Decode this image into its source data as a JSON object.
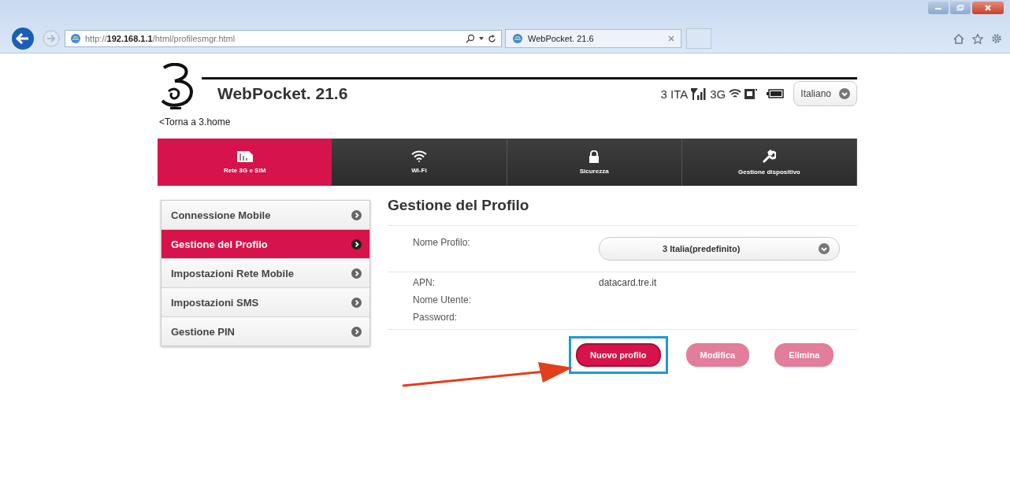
{
  "browser": {
    "url_prefix": "http://",
    "url_host": "192.168.1.1",
    "url_path": "/html/profilesmgr.html",
    "tab_title": "WebPocket. 21.6"
  },
  "header": {
    "title": "WebPocket. 21.6",
    "operator": "3 ITA",
    "network": "3G",
    "language": "Italiano",
    "back_link": "<Torna a 3.home"
  },
  "tabs": [
    {
      "label": "Rete 3G e SIM",
      "kind": "sim",
      "selected": true
    },
    {
      "label": "Wi-Fi",
      "kind": "wifi",
      "selected": false
    },
    {
      "label": "Sicurezza",
      "kind": "lock",
      "selected": false
    },
    {
      "label": "Gestione dispositivo",
      "kind": "wrench",
      "selected": false
    }
  ],
  "sidebar": {
    "items": [
      {
        "label": "Connessione Mobile",
        "selected": false
      },
      {
        "label": "Gestione del Profilo",
        "selected": true
      },
      {
        "label": "Impostazioni Rete Mobile",
        "selected": false
      },
      {
        "label": "Impostazioni SMS",
        "selected": false
      },
      {
        "label": "Gestione PIN",
        "selected": false
      }
    ]
  },
  "panel": {
    "title": "Gestione del Profilo",
    "profile_label": "Nome Profilo:",
    "profile_value": "3 Italia(predefinito)",
    "fields": [
      {
        "label": "APN:",
        "value": "datacard.tre.it"
      },
      {
        "label": "Nome Utente:"
      },
      {
        "label": "Password:"
      }
    ],
    "buttons": [
      {
        "label": "Nuovo profilo",
        "disabled": false,
        "highlighted": true
      },
      {
        "label": "Modifica",
        "disabled": true,
        "highlighted": false
      },
      {
        "label": "Elimina",
        "disabled": true,
        "highlighted": false
      }
    ]
  }
}
